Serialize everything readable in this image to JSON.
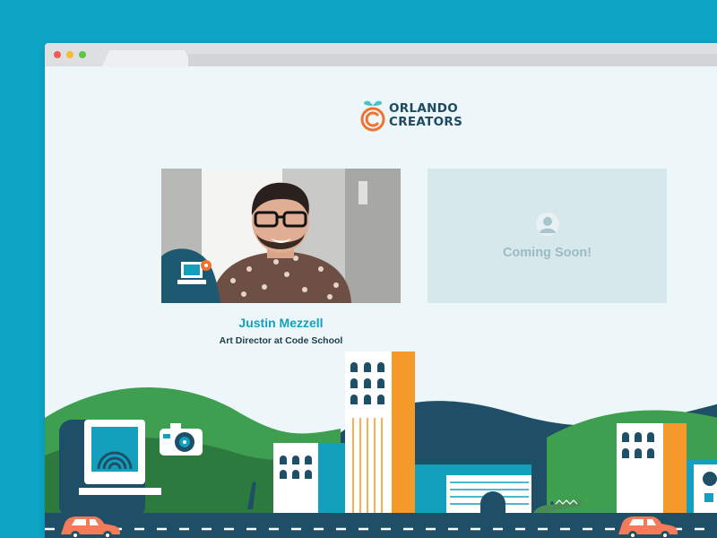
{
  "brand": {
    "line1": "ORLANDO",
    "line2": "CREATORS",
    "colors": {
      "orange": "#f0722f",
      "leaf": "#4bc3c5",
      "navy": "#1d4a60"
    }
  },
  "featured": {
    "name": "Justin Mezzell",
    "role": "Art Director at Code School"
  },
  "placeholder": {
    "label": "Coming Soon!"
  },
  "colors": {
    "background": "#0ea4c6",
    "page": "#edf6f9",
    "accent": "#13a0bd",
    "road": "#1f4f66",
    "hills": "#2d7a3f",
    "building_orange": "#f59a2a",
    "car": "#f47b5a"
  }
}
